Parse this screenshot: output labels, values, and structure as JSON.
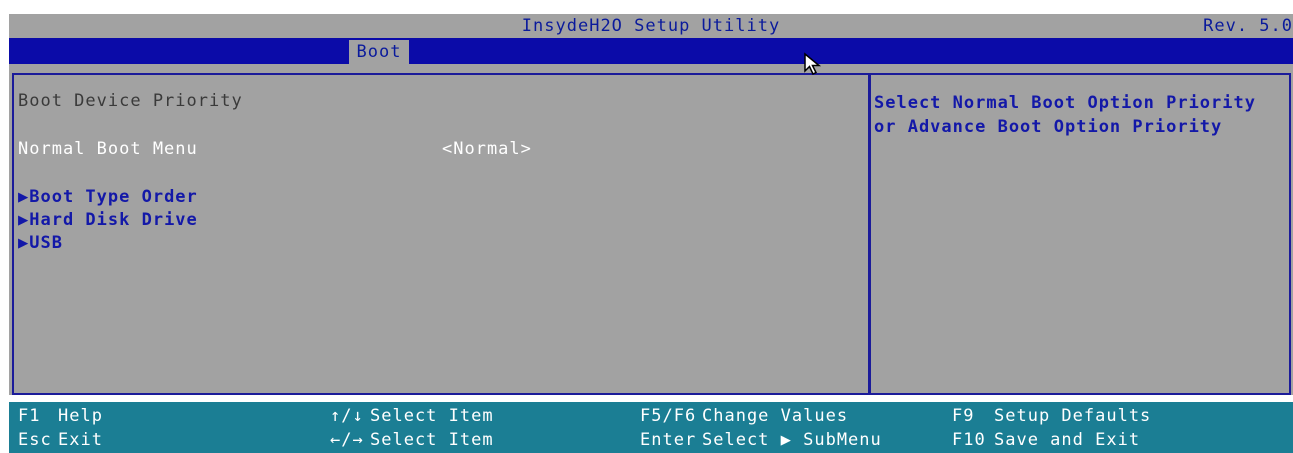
{
  "title": "InsydeH2O Setup Utility",
  "revision": "Rev. 5.0",
  "active_tab": "Boot",
  "main": {
    "section_title": "Boot Device Priority",
    "normal_boot_menu": {
      "label": "Normal Boot Menu",
      "value": "<Normal>"
    },
    "submenus": [
      {
        "label": "Boot Type Order"
      },
      {
        "label": "Hard Disk Drive"
      },
      {
        "label": "USB"
      }
    ]
  },
  "help": "Select Normal Boot Option Priority or Advance Boot Option Priority",
  "footer": {
    "f1": {
      "key": "F1",
      "action": "Help"
    },
    "esc": {
      "key": "Esc",
      "action": "Exit"
    },
    "updown": {
      "key": "↑/↓",
      "action": "Select Item"
    },
    "leftright": {
      "key": "←/→",
      "action": "Select Item"
    },
    "f5f6": {
      "key": "F5/F6",
      "action": "Change Values"
    },
    "enter": {
      "key": "Enter",
      "action": "Select ▶ SubMenu"
    },
    "f9": {
      "key": "F9",
      "action": "Setup Defaults"
    },
    "f10": {
      "key": "F10",
      "action": "Save and Exit"
    }
  },
  "colors": {
    "background_gray": "#a2a2a2",
    "tab_bar_blue": "#0b0ba8",
    "footer_teal": "#1b7e94",
    "highlight_blue": "#1318a8"
  },
  "icons": {
    "submenu_marker": "submenu-arrow-icon",
    "cursor": "mouse-pointer-icon"
  }
}
